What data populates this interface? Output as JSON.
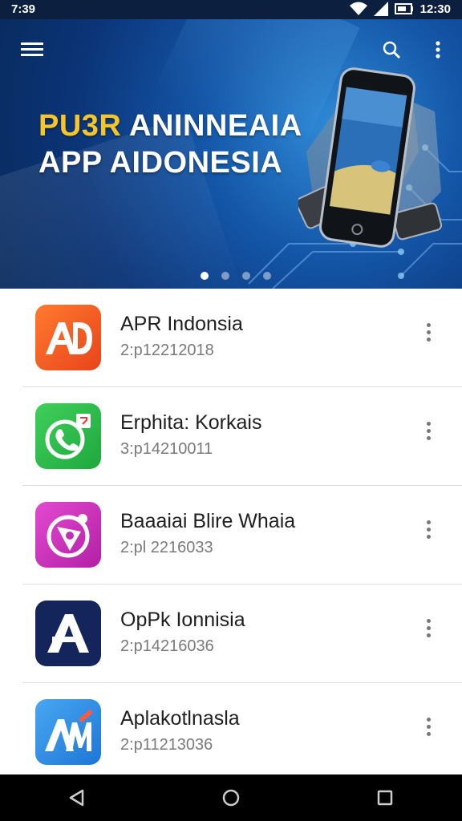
{
  "status": {
    "time": "7:39",
    "clock": "12:30"
  },
  "hero": {
    "title_accent": "PU3R",
    "title_line1_rest": "ANINNEAIA",
    "title_line2": "APP AIDONESIA",
    "pager": {
      "count": 4,
      "active": 0
    }
  },
  "toolbar": {
    "menu_icon": "hamburger-menu-icon",
    "search_icon": "search-icon",
    "overflow_icon": "more-vert-icon"
  },
  "apps": [
    {
      "name": "APR Indonsia",
      "date": "2:p12212018",
      "icon": "ad-logo-icon",
      "color": "#f15a22"
    },
    {
      "name": "Erphita: Korkais",
      "date": "3:p14210011",
      "icon": "phone-chat-icon",
      "color": "#27b84a"
    },
    {
      "name": "Baaaiai Blire Whaia",
      "date": "2:pl 2216033",
      "icon": "compass-target-icon",
      "color": "#c22fb5"
    },
    {
      "name": "OpPk Ionnisia",
      "date": "2:p14216036",
      "icon": "letter-a-icon",
      "color": "#13255a"
    },
    {
      "name": "Aplakotlnasla",
      "date": "2:p11213036",
      "icon": "am-pen-icon",
      "color": "#2f8fe6"
    }
  ],
  "navbar": {
    "back_icon": "back-triangle-icon",
    "home_icon": "home-circle-icon",
    "recents_icon": "recents-square-icon"
  }
}
